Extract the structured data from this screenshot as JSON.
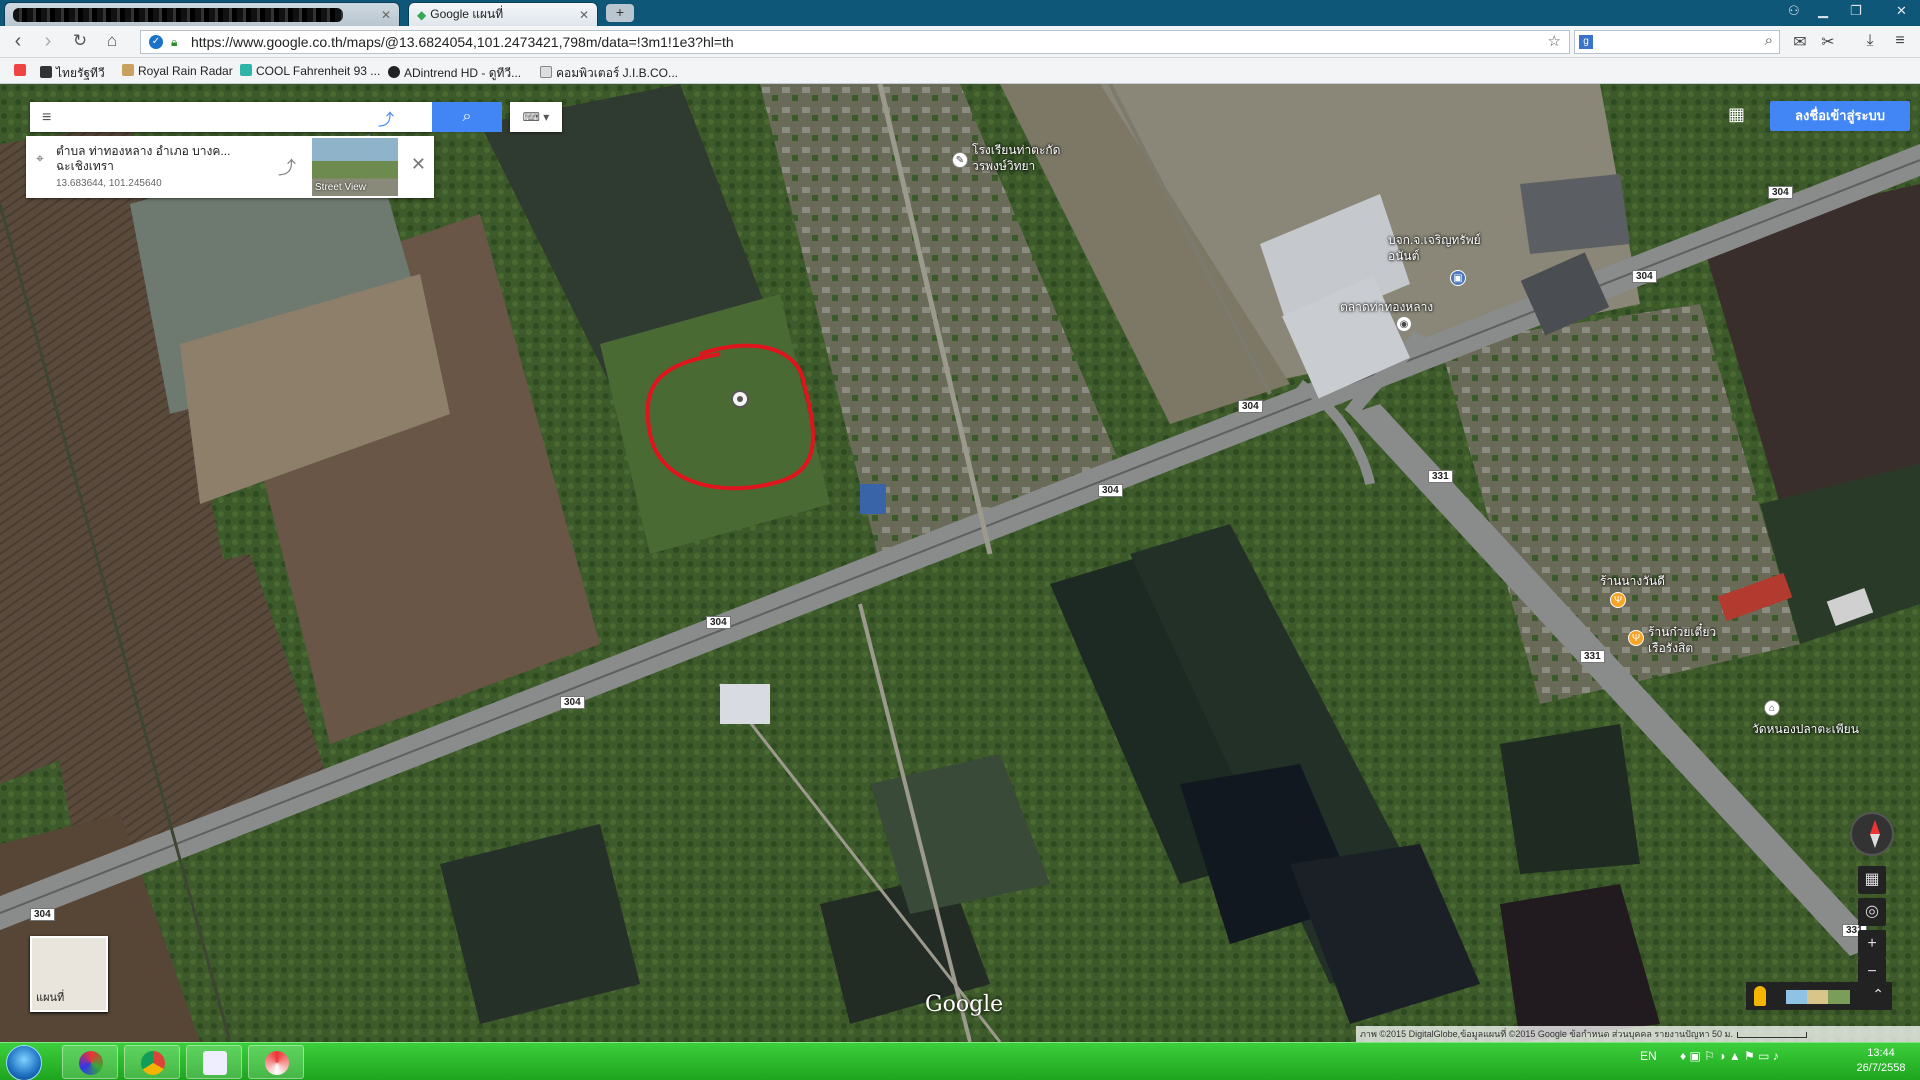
{
  "browser": {
    "tabs": [
      {
        "title": "",
        "active": false
      },
      {
        "title": "Google แผนที่",
        "active": true
      }
    ],
    "new_tab_label": "+",
    "url": "https://www.google.co.th/maps/@13.6824054,101.2473421,798m/data=!3m1!1e3?hl=th",
    "bookmarks": [
      {
        "label": "ไทยรัฐทีวี",
        "color": "#333333"
      },
      {
        "label": "Royal Rain Radar",
        "color": "#c8a060"
      },
      {
        "label": "COOL Fahrenheit 93 ...",
        "color": "#2fb5a8"
      },
      {
        "label": "ADintrend HD - ดูทีวี...",
        "color": "#222222"
      },
      {
        "label": "คอมพิวเตอร์ J.I.B.CO...",
        "color": "#dddddd"
      }
    ]
  },
  "maps": {
    "search_placeholder": "",
    "place_card": {
      "address": "ตำบล ท่าทองหลาง อำเภอ บางค... ฉะเชิงเทรา",
      "coords": "13.683644, 101.245640",
      "street_view_label": "Street View"
    },
    "sign_in_label": "ลงชื่อเข้าสู่ระบบ",
    "minimap_label": "แผนที่",
    "google_logo": "Google",
    "attribution": "ภาพ ©2015 DigitalGlobe,ข้อมูลแผนที่ ©2015 Google   ข้อกำหนด   ส่วนบุคคล   รายงานปัญหา   50 ม.",
    "road_labels": [
      "304",
      "304",
      "304",
      "304",
      "304",
      "304",
      "304",
      "331",
      "331",
      "331"
    ],
    "pois": [
      {
        "name": "โรงเรียนท่าตะกัด วรพงษ์วิทยา",
        "type": "school"
      },
      {
        "name": "บจก.จ.เจริญทรัพย์ อนันต์",
        "type": "business"
      },
      {
        "name": "ตลาดท่าทองหลาง",
        "type": "market"
      },
      {
        "name": "ร้านนางวันดี",
        "type": "food"
      },
      {
        "name": "ร้านก๋วยเตี๋ยว เรือรังสิต",
        "type": "food"
      },
      {
        "name": "วัดหนองปลาตะเพียน",
        "type": "temple"
      }
    ]
  },
  "taskbar": {
    "language": "EN",
    "time": "13:44",
    "date": "26/7/2558"
  }
}
